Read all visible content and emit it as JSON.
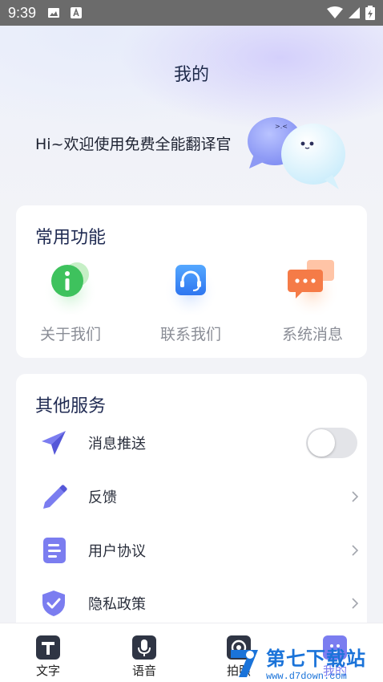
{
  "status_bar": {
    "time": "9:39"
  },
  "header": {
    "title": "我的",
    "greeting": "Hi~欢迎使用免费全能翻译官"
  },
  "common_functions": {
    "title": "常用功能",
    "items": [
      {
        "label": "关于我们",
        "icon": "info-icon"
      },
      {
        "label": "联系我们",
        "icon": "headset-icon"
      },
      {
        "label": "系统消息",
        "icon": "chat-bubbles-icon"
      }
    ]
  },
  "other_services": {
    "title": "其他服务",
    "items": [
      {
        "label": "消息推送",
        "icon": "paper-plane-icon",
        "control": "toggle",
        "enabled": false
      },
      {
        "label": "反馈",
        "icon": "pencil-icon",
        "control": "chevron"
      },
      {
        "label": "用户协议",
        "icon": "document-icon",
        "control": "chevron"
      },
      {
        "label": "隐私政策",
        "icon": "shield-check-icon",
        "control": "chevron"
      }
    ]
  },
  "tab_bar": {
    "tabs": [
      {
        "label": "文字",
        "icon": "text-t-icon"
      },
      {
        "label": "语音",
        "icon": "microphone-icon"
      },
      {
        "label": "拍照",
        "icon": "camera-icon"
      },
      {
        "label": "我的",
        "icon": "profile-icon",
        "active": true
      }
    ]
  },
  "watermark": {
    "text": "第七下载站",
    "url": "www.d7down.com"
  },
  "colors": {
    "accent": "#7b7df0",
    "title": "#1f2a52",
    "muted_label": "#8a8d96"
  }
}
